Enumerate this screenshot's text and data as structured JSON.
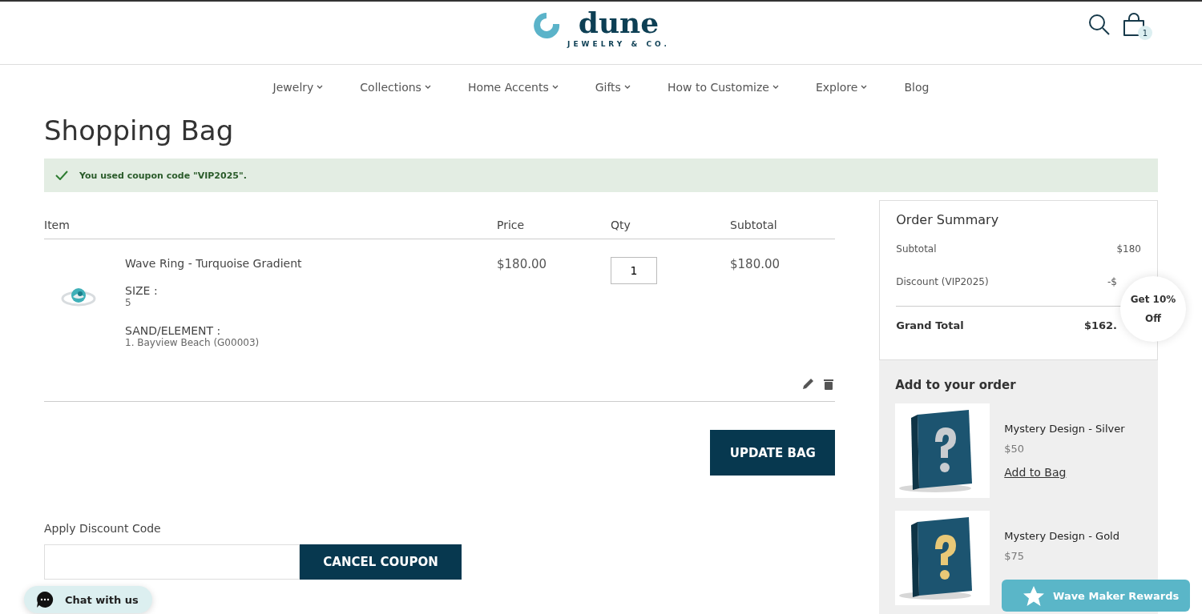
{
  "header": {
    "logo": "dune",
    "tagline": "JEWELRY & CO.",
    "cart_count": "1"
  },
  "nav": [
    {
      "label": "Jewelry",
      "dropdown": true
    },
    {
      "label": "Collections",
      "dropdown": true
    },
    {
      "label": "Home Accents",
      "dropdown": true
    },
    {
      "label": "Gifts",
      "dropdown": true
    },
    {
      "label": "How to Customize",
      "dropdown": true
    },
    {
      "label": "Explore",
      "dropdown": true
    },
    {
      "label": "Blog",
      "dropdown": false
    }
  ],
  "page_title": "Shopping Bag",
  "notice": "You used coupon code \"VIP2025\".",
  "table": {
    "columns": [
      "Item",
      "Price",
      "Qty",
      "Subtotal"
    ],
    "rows": [
      {
        "name": "Wave Ring - Turquoise Gradient",
        "options": [
          {
            "label": "SIZE :",
            "value": "5"
          },
          {
            "label": "SAND/ELEMENT :",
            "value": "1. Bayview Beach (G00003)"
          }
        ],
        "price": "$180.00",
        "qty": "1",
        "subtotal": "$180.00"
      }
    ]
  },
  "update_button": "UPDATE BAG",
  "discount": {
    "label": "Apply Discount Code",
    "button": "CANCEL COUPON"
  },
  "summary": {
    "title": "Order Summary",
    "lines": [
      {
        "label": "Subtotal",
        "value": "$180"
      },
      {
        "label": "Discount (VIP2025)",
        "value": "-$"
      }
    ],
    "total_label": "Grand Total",
    "total_value": "$162."
  },
  "upsell": {
    "title": "Add to your order",
    "items": [
      {
        "name": "Mystery Design - Silver",
        "price": "$50",
        "link": "Add to Bag",
        "color": "#c9ccd0"
      },
      {
        "name": "Mystery Design - Gold",
        "price": "$75",
        "color": "#e8c877"
      }
    ]
  },
  "promo": {
    "line1": "Get 10%",
    "line2": "Off"
  },
  "chat": "Chat with us",
  "rewards": "Wave Maker Rewards"
}
